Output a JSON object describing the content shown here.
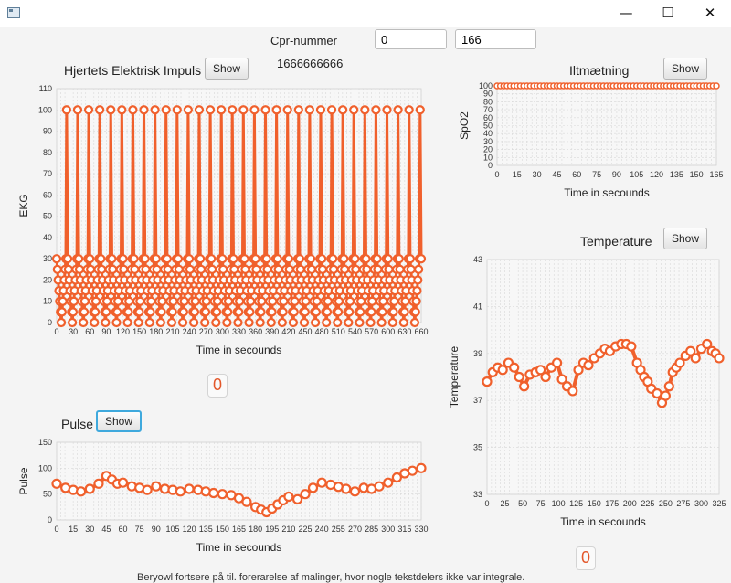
{
  "window": {
    "minimize_glyph": "—",
    "maximize_glyph": "☐",
    "close_glyph": "✕"
  },
  "cpr": {
    "label": "Cpr-nummer",
    "value_1": "0",
    "value_2": "166",
    "number": "1666666666"
  },
  "buttons": {
    "show": "Show"
  },
  "counters": {
    "ekg": "0",
    "temperature": "0"
  },
  "accent_color": "#f0602c",
  "bottom_text": "Beryowl fortsere på til. forerarelse af malinger, hvor nogle tekstdelers ikke var integrale.",
  "charts": {
    "ekg": {
      "title": "Hjertets Elektrisk Impuls",
      "xlabel": "Time in secounds",
      "ylabel": "EKG"
    },
    "spo2": {
      "title": "Iltmætning",
      "xlabel": "Time in secounds",
      "ylabel": "SpO2"
    },
    "temperature": {
      "title": "Temperature",
      "xlabel": "Time in secounds",
      "ylabel": "Temperature"
    },
    "pulse": {
      "title": "Pulse",
      "xlabel": "Time in secounds",
      "ylabel": "Pulse"
    }
  },
  "chart_data": [
    {
      "id": "ekg",
      "type": "line",
      "xlim": [
        0,
        660
      ],
      "ylim": [
        0,
        110
      ],
      "xticks": [
        0,
        30,
        60,
        90,
        120,
        150,
        180,
        210,
        240,
        270,
        300,
        330,
        360,
        390,
        420,
        450,
        480,
        510,
        540,
        570,
        600,
        630,
        660
      ],
      "yticks": [
        0,
        10,
        20,
        30,
        40,
        50,
        60,
        70,
        80,
        90,
        100,
        110
      ],
      "pattern": {
        "period_s": 20,
        "peak": 100,
        "values": [
          30,
          25,
          20,
          15,
          10,
          5,
          0,
          5,
          10,
          15,
          20,
          25,
          30,
          100
        ]
      }
    },
    {
      "id": "spo2",
      "type": "line",
      "xlim": [
        0,
        165
      ],
      "ylim": [
        0,
        100
      ],
      "xticks": [
        0,
        15,
        30,
        45,
        60,
        75,
        90,
        105,
        120,
        135,
        150,
        165
      ],
      "yticks": [
        0,
        10,
        20,
        30,
        40,
        50,
        60,
        70,
        80,
        90,
        100
      ],
      "value": 100
    },
    {
      "id": "temperature",
      "type": "line",
      "xlim": [
        0,
        325
      ],
      "ylim": [
        33,
        43
      ],
      "xticks": [
        0,
        25,
        50,
        75,
        100,
        125,
        150,
        175,
        200,
        225,
        250,
        275,
        300,
        325
      ],
      "yticks": [
        33,
        35,
        37,
        39,
        41,
        43
      ],
      "x": [
        0,
        8,
        15,
        22,
        30,
        38,
        45,
        52,
        60,
        68,
        75,
        82,
        90,
        98,
        105,
        112,
        120,
        128,
        135,
        142,
        150,
        158,
        165,
        172,
        180,
        188,
        195,
        202,
        210,
        215,
        220,
        225,
        230,
        238,
        245,
        250,
        255,
        260,
        265,
        270,
        278,
        285,
        292,
        300,
        308,
        315,
        320,
        325
      ],
      "y": [
        37.8,
        38.2,
        38.4,
        38.3,
        38.6,
        38.4,
        38.0,
        37.6,
        38.1,
        38.2,
        38.3,
        38.0,
        38.4,
        38.6,
        37.9,
        37.6,
        37.4,
        38.3,
        38.6,
        38.5,
        38.8,
        39.0,
        39.2,
        39.1,
        39.3,
        39.4,
        39.4,
        39.3,
        38.6,
        38.3,
        38.0,
        37.8,
        37.5,
        37.3,
        36.9,
        37.2,
        37.6,
        38.2,
        38.4,
        38.6,
        38.9,
        39.1,
        38.8,
        39.2,
        39.4,
        39.1,
        39.0,
        38.8
      ]
    },
    {
      "id": "pulse",
      "type": "line",
      "xlim": [
        0,
        330
      ],
      "ylim": [
        0,
        150
      ],
      "xticks": [
        0,
        15,
        30,
        45,
        60,
        75,
        90,
        105,
        120,
        135,
        150,
        165,
        180,
        195,
        210,
        225,
        240,
        255,
        270,
        285,
        300,
        315,
        330
      ],
      "yticks": [
        0,
        50,
        100,
        150
      ],
      "x": [
        0,
        8,
        15,
        22,
        30,
        38,
        45,
        50,
        55,
        60,
        68,
        75,
        82,
        90,
        98,
        105,
        112,
        120,
        128,
        135,
        142,
        150,
        158,
        165,
        172,
        180,
        185,
        190,
        195,
        200,
        205,
        210,
        218,
        225,
        232,
        240,
        248,
        255,
        262,
        270,
        278,
        285,
        292,
        300,
        308,
        315,
        322,
        330
      ],
      "y": [
        70,
        62,
        58,
        55,
        60,
        70,
        85,
        78,
        70,
        72,
        65,
        62,
        58,
        65,
        60,
        58,
        55,
        60,
        58,
        55,
        52,
        50,
        48,
        42,
        35,
        25,
        20,
        15,
        22,
        30,
        38,
        45,
        40,
        50,
        62,
        72,
        68,
        64,
        60,
        55,
        62,
        60,
        65,
        72,
        82,
        90,
        95,
        100
      ]
    }
  ]
}
